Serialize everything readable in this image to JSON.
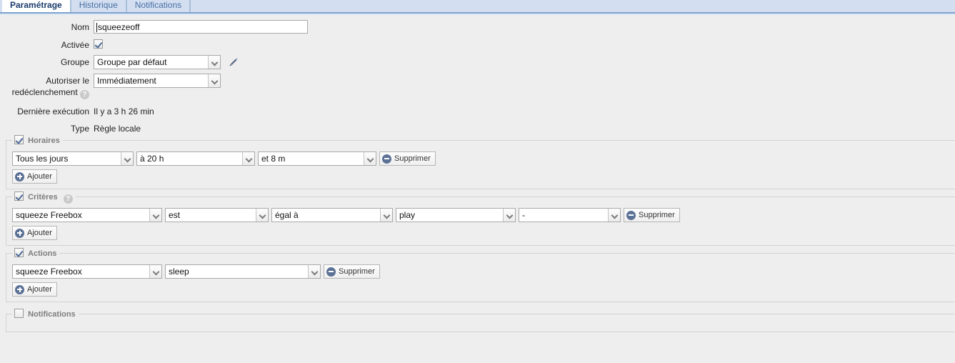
{
  "tabs": [
    {
      "label": "Paramétrage",
      "active": true
    },
    {
      "label": "Historique",
      "active": false
    },
    {
      "label": "Notifications",
      "active": false
    }
  ],
  "form": {
    "nom_label": "Nom",
    "nom_value": "squeezeoff",
    "activee_label": "Activée",
    "activee_checked": true,
    "groupe_label": "Groupe",
    "groupe_value": "Groupe par défaut",
    "autoriser_label_line1": "Autoriser le",
    "autoriser_label_line2": "redéclenchement",
    "autoriser_value": "Immédiatement",
    "help_glyph": "?",
    "derniere_label": "Dernière exécution",
    "derniere_value": "Il y a 3 h 26 min",
    "type_label": "Type",
    "type_value": "Règle locale"
  },
  "horaires": {
    "legend": "Horaires",
    "checked": true,
    "rows": [
      {
        "day": "Tous les jours",
        "hour": "à 20 h",
        "minute": "et 8 m",
        "delete_label": "Supprimer"
      }
    ],
    "add_label": "Ajouter"
  },
  "criteres": {
    "legend": "Critères",
    "checked": true,
    "help_glyph": "?",
    "rows": [
      {
        "source": "squeeze Freebox",
        "verb": "est",
        "operator": "égal à",
        "value": "play",
        "extra": "-",
        "delete_label": "Supprimer"
      }
    ],
    "add_label": "Ajouter"
  },
  "actions": {
    "legend": "Actions",
    "checked": true,
    "rows": [
      {
        "target": "squeeze Freebox",
        "command": "sleep",
        "delete_label": "Supprimer"
      }
    ],
    "add_label": "Ajouter"
  },
  "notifications": {
    "legend": "Notifications",
    "checked": false
  },
  "colors": {
    "tab_active_text": "#1b3d6d",
    "tab_inactive_text": "#4a6fa5",
    "tabbar_bg": "#d3dff0",
    "page_bg": "#eeeeee",
    "icon_blue": "#5b7196",
    "legend_text": "#7d7d7d"
  }
}
